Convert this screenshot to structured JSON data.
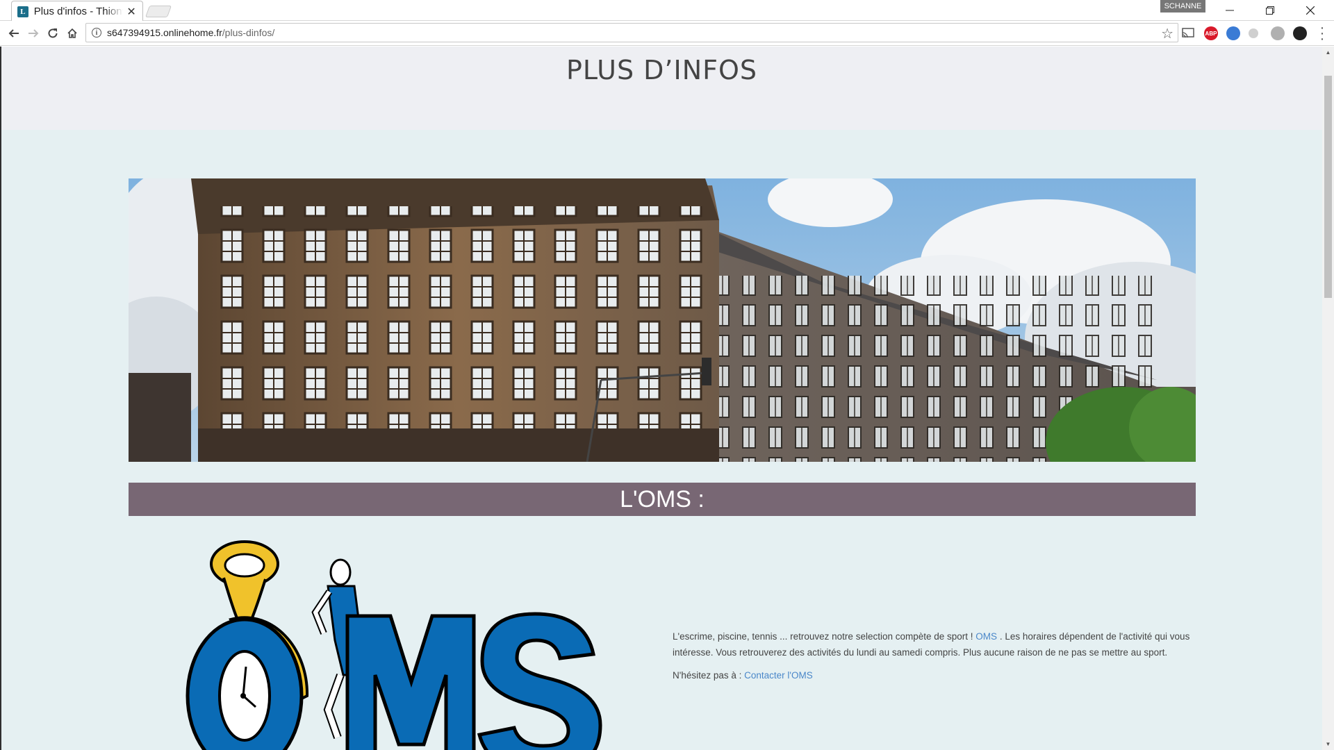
{
  "browser": {
    "tab_title": "Plus d'infos - Thionville",
    "tab_favicon": "L",
    "profile_name": "SCHANNE",
    "url_host": "s647394915.onlinehome.fr",
    "url_path": "/plus-dinfos/",
    "extensions": [
      {
        "name": "adblock-plus-icon",
        "label": "ABP",
        "color": "#d9192a"
      },
      {
        "name": "extension-icon-2",
        "label": "",
        "color": "#3a7bd5"
      },
      {
        "name": "extension-icon-3",
        "label": "",
        "color": "#bdbdbd"
      },
      {
        "name": "extension-icon-4",
        "label": "",
        "color": "#9e9e9e"
      },
      {
        "name": "extension-icon-5",
        "label": "",
        "color": "#222222"
      }
    ]
  },
  "page": {
    "title": "PLUS D’INFOS",
    "section_heading": "L'OMS :",
    "paragraph1_text1": "L'escrime, piscine, tennis ... retrouvez notre selection compète de sport ! ",
    "paragraph1_link": "OMS",
    "paragraph1_text2": " . Les horaires dépendent de l'activité qui vous intéresse. Vous retrouverez des activités du lundi au samedi compris. Plus aucune raison de ne pas se mettre au sport.",
    "paragraph2_text": "N'hésitez pas à : ",
    "paragraph2_link": "Contacter l'OMS",
    "logo_text": "OMS"
  },
  "colors": {
    "page_background": "#e5f0f2",
    "header_background": "#eeeff3",
    "banner_background": "#786774",
    "link": "#4a87c9",
    "logo_blue": "#0a6bb5",
    "logo_gold": "#f0c22b"
  }
}
